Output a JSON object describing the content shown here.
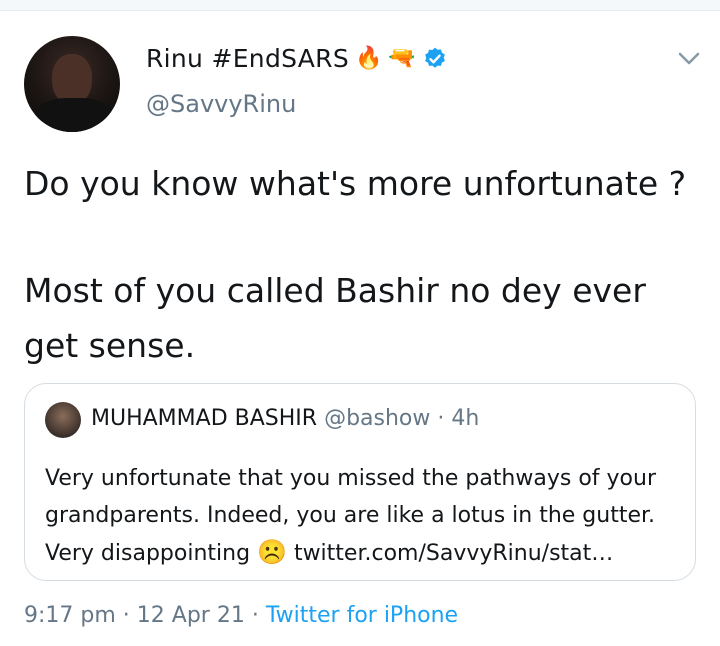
{
  "tweet": {
    "display_name": "Rinu #EndSARS",
    "name_emojis": [
      "🔥",
      "🔫"
    ],
    "handle": "@SavvyRinu",
    "text_line1": "Do you know what's more unfortunate ?",
    "text_line2": "Most of you called Bashir no dey ever",
    "text_line3": "get sense."
  },
  "quoted": {
    "name": "MUHAMMAD BASHIR",
    "handle": "@bashow",
    "separator": "·",
    "time": "4h",
    "line1": "Very unfortunate that you missed the pathways of your",
    "line2": "grandparents. Indeed, you are like a lotus in the gutter.",
    "line3_pre": "Very disappointing",
    "line3_emoji": "☹️",
    "line3_link": "twitter.com/SavvyRinu/stat…"
  },
  "meta": {
    "time": "9:17 pm",
    "sep1": "·",
    "date": "12 Apr 21",
    "sep2": "·",
    "source": "Twitter for iPhone"
  },
  "colors": {
    "link": "#1da1f2",
    "secondary": "#657786",
    "verified": "#1da1f2"
  },
  "icons": [
    "verified-badge-icon",
    "chevron-down-icon"
  ]
}
